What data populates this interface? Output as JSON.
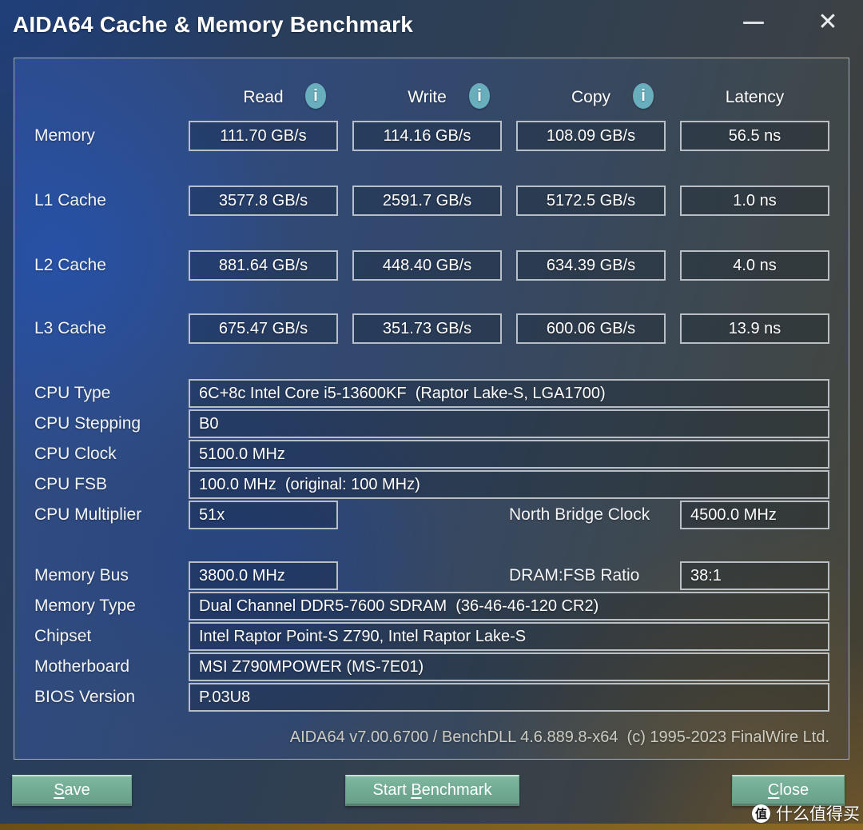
{
  "window": {
    "title": "AIDA64 Cache & Memory Benchmark",
    "minimize_glyph": "—",
    "close_glyph": "✕"
  },
  "benchmark": {
    "columns": [
      {
        "label": "Read",
        "info_glyph": "i"
      },
      {
        "label": "Write",
        "info_glyph": "i"
      },
      {
        "label": "Copy",
        "info_glyph": "i"
      },
      {
        "label": "Latency"
      }
    ],
    "rows": [
      {
        "label": "Memory",
        "read": "111.70 GB/s",
        "write": "114.16 GB/s",
        "copy": "108.09 GB/s",
        "latency": "56.5 ns"
      },
      {
        "label": "L1 Cache",
        "read": "3577.8 GB/s",
        "write": "2591.7 GB/s",
        "copy": "5172.5 GB/s",
        "latency": "1.0 ns"
      },
      {
        "label": "L2 Cache",
        "read": "881.64 GB/s",
        "write": "448.40 GB/s",
        "copy": "634.39 GB/s",
        "latency": "4.0 ns"
      },
      {
        "label": "L3 Cache",
        "read": "675.47 GB/s",
        "write": "351.73 GB/s",
        "copy": "600.06 GB/s",
        "latency": "13.9 ns"
      }
    ]
  },
  "cpu_info": {
    "rows": [
      {
        "label": "CPU Type",
        "value": "6C+8c Intel Core i5-13600KF  (Raptor Lake-S, LGA1700)"
      },
      {
        "label": "CPU Stepping",
        "value": "B0"
      },
      {
        "label": "CPU Clock",
        "value": "5100.0 MHz"
      },
      {
        "label": "CPU FSB",
        "value": "100.0 MHz  (original: 100 MHz)"
      },
      {
        "label": "CPU Multiplier",
        "value": "51x",
        "extra_label": "North Bridge Clock",
        "extra_value": "4500.0 MHz"
      }
    ]
  },
  "memory_info": {
    "rows": [
      {
        "label": "Memory Bus",
        "value": "3800.0 MHz",
        "extra_label": "DRAM:FSB Ratio",
        "extra_value": "38:1"
      },
      {
        "label": "Memory Type",
        "value": "Dual Channel DDR5-7600 SDRAM  (36-46-46-120 CR2)"
      },
      {
        "label": "Chipset",
        "value": "Intel Raptor Point-S Z790, Intel Raptor Lake-S"
      },
      {
        "label": "Motherboard",
        "value": "MSI Z790MPOWER (MS-7E01)"
      },
      {
        "label": "BIOS Version",
        "value": "P.03U8"
      }
    ]
  },
  "footer": {
    "text": "AIDA64 v7.00.6700 / BenchDLL 4.6.889.8-x64  (c) 1995-2023 FinalWire Ltd."
  },
  "buttons": {
    "save": {
      "pre": "",
      "key": "S",
      "post": "ave"
    },
    "start": {
      "pre": "Start ",
      "key": "B",
      "post": "enchmark"
    },
    "close": {
      "pre": "",
      "key": "C",
      "post": "lose"
    }
  },
  "watermark": {
    "logo_char": "值",
    "text": "什么值得买"
  },
  "colors": {
    "info_icon": "#68aebd",
    "button": "#74ac96",
    "panel_border": "#dfe3e6",
    "bottom_strip": "#7d5e1d"
  }
}
